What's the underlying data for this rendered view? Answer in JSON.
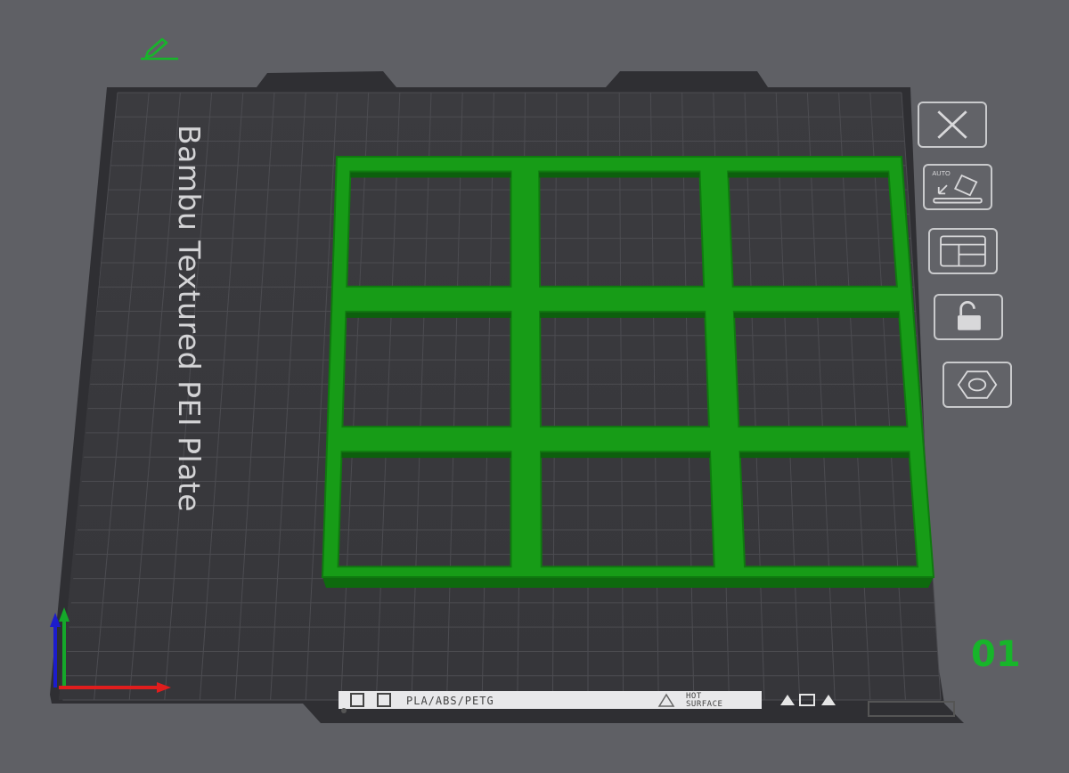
{
  "plate": {
    "name": "Bambu Textured PEI Plate",
    "number": "01",
    "material_strip": "PLA/ABS/PETG",
    "hot_surface": [
      "HOT",
      "SURFACE"
    ]
  },
  "toolbar": {
    "buttons": [
      {
        "name": "close-plate-button",
        "icon": "close-icon"
      },
      {
        "name": "auto-orient-button",
        "icon": "auto-orient-icon",
        "label": "AUTO"
      },
      {
        "name": "arrange-button",
        "icon": "arrange-icon"
      },
      {
        "name": "lock-plate-button",
        "icon": "unlock-icon"
      },
      {
        "name": "plate-settings-button",
        "icon": "hexagon-settings-icon"
      }
    ]
  },
  "colors": {
    "background": "#5f6065",
    "plate": "#3a3a3e",
    "grid": "#4d4d52",
    "model": "#179c17",
    "accent_green": "#17b52a",
    "axis_x": "#e01d1d",
    "axis_y": "#15a82a",
    "axis_z": "#1c1ccc"
  },
  "icons": [
    "edit-plate-name-icon",
    "axis-gizmo"
  ]
}
